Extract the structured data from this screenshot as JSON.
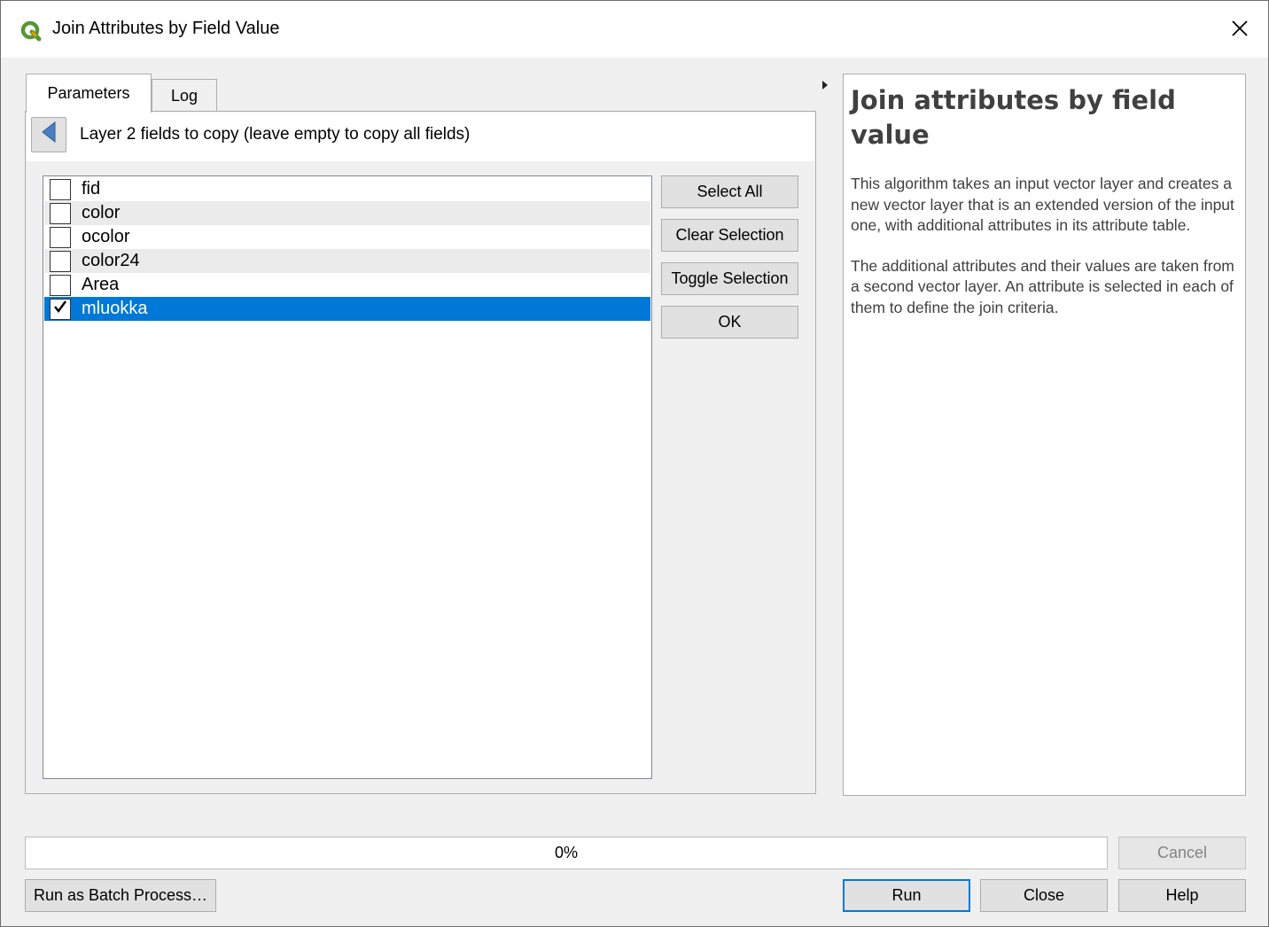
{
  "window": {
    "title": "Join Attributes by Field Value",
    "close_icon": "close-icon"
  },
  "tabs": [
    {
      "label": "Parameters",
      "active": true
    },
    {
      "label": "Log",
      "active": false
    }
  ],
  "panel": {
    "header_label": "Layer 2 fields to copy (leave empty to copy all fields)",
    "back_icon": "back-arrow-icon"
  },
  "fields": [
    {
      "label": "fid",
      "checked": false
    },
    {
      "label": "color",
      "checked": false
    },
    {
      "label": "ocolor",
      "checked": false
    },
    {
      "label": "color24",
      "checked": false
    },
    {
      "label": "Area",
      "checked": false
    },
    {
      "label": "mluokka",
      "checked": true,
      "selected": true
    }
  ],
  "side_buttons": {
    "select_all": "Select All",
    "clear_selection": "Clear Selection",
    "toggle_selection": "Toggle Selection",
    "ok": "OK"
  },
  "help": {
    "title": "Join attributes by field value",
    "paragraphs": [
      "This algorithm takes an input vector layer and creates a new vector layer that is an extended version of the input one, with additional attributes in its attribute table.",
      "The additional attributes and their values are taken from a second vector layer. An attribute is selected in each of them to define the join criteria."
    ]
  },
  "progress": {
    "label": "0%",
    "value": 0
  },
  "footer": {
    "cancel": "Cancel",
    "batch": "Run as Batch Process…",
    "run": "Run",
    "close": "Close",
    "help": "Help"
  },
  "colors": {
    "selection": "#0078d7",
    "qgis_green": "#589632",
    "qgis_yellow": "#ee9c00"
  }
}
